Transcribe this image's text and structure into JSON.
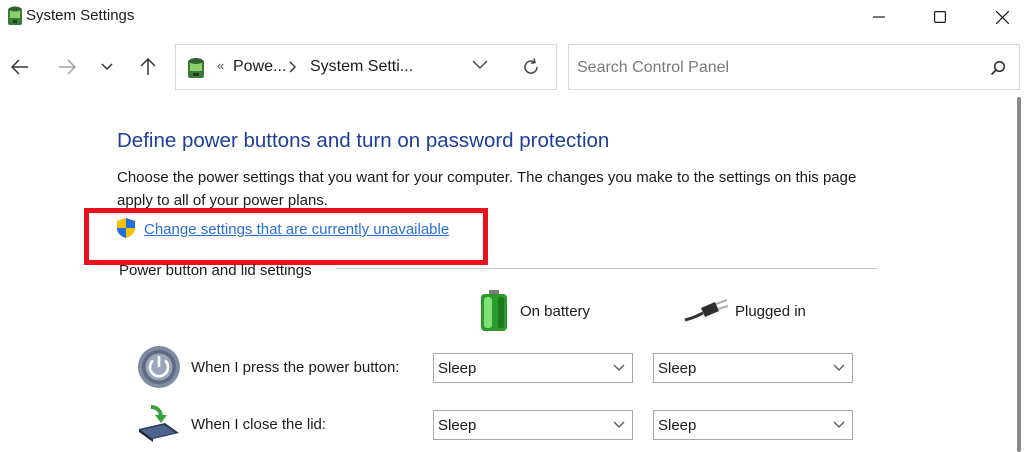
{
  "window": {
    "title": "System Settings"
  },
  "address": {
    "overflow": "«",
    "crumbs": [
      "Powe...",
      "System Setti..."
    ]
  },
  "search": {
    "placeholder": "Search Control Panel"
  },
  "content": {
    "title": "Define power buttons and turn on password protection",
    "description": "Choose the power settings that you want for your computer. The changes you make to the settings on this page apply to all of your power plans.",
    "change_link": "Change settings that are currently unavailable",
    "section_label": "Power button and lid settings",
    "columns": {
      "battery": "On battery",
      "plugged": "Plugged in"
    },
    "rows": [
      {
        "label": "When I press the power button:",
        "battery": "Sleep",
        "plugged": "Sleep"
      },
      {
        "label": "When I close the lid:",
        "battery": "Sleep",
        "plugged": "Sleep"
      }
    ]
  },
  "colors": {
    "title_blue": "#1e3e9e",
    "link_blue": "#2a6fd6",
    "highlight_red": "#e8121d"
  },
  "icons": [
    "app-icon",
    "minimize-icon",
    "maximize-icon",
    "close-icon",
    "back-arrow-icon",
    "forward-arrow-icon",
    "recent-dropdown-icon",
    "up-arrow-icon",
    "control-panel-icon",
    "chevron-right-icon",
    "chevron-down-icon",
    "refresh-icon",
    "search-icon",
    "uac-shield-icon",
    "battery-icon",
    "plug-icon",
    "power-button-icon",
    "laptop-lid-icon"
  ]
}
